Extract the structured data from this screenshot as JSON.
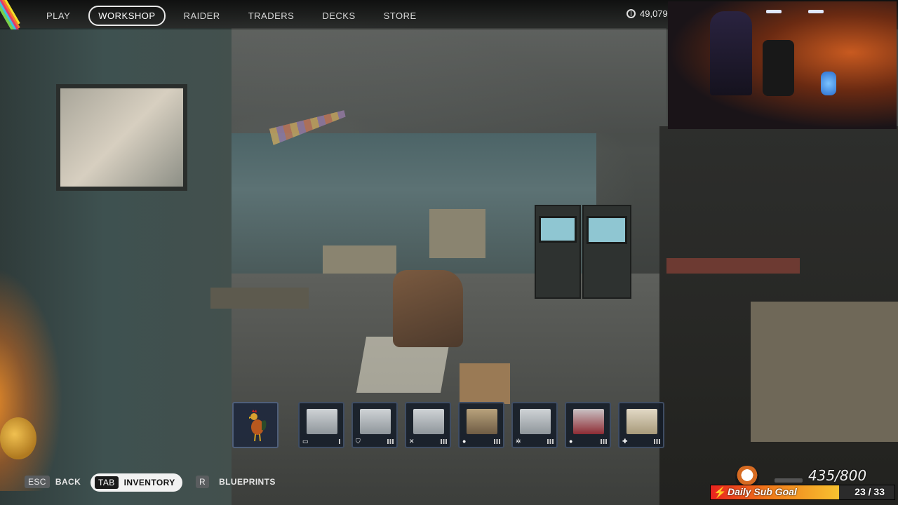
{
  "nav": {
    "items": [
      {
        "label": "PLAY"
      },
      {
        "label": "WORKSHOP",
        "active": true
      },
      {
        "label": "RAIDER"
      },
      {
        "label": "TRADERS"
      },
      {
        "label": "DECKS"
      },
      {
        "label": "STORE"
      }
    ],
    "currency": {
      "value": "49,079",
      "icon": "coin-icon"
    }
  },
  "inventory": {
    "featured": {
      "icon": "rooster-icon"
    },
    "slots": [
      {
        "name": "workstation-1",
        "badge_icon": "bench-icon",
        "level_bars": 1
      },
      {
        "name": "workstation-2",
        "badge_icon": "shield-icon",
        "level_bars": 3
      },
      {
        "name": "workstation-3",
        "badge_icon": "crossed-tools-icon",
        "level_bars": 3
      },
      {
        "name": "workstation-4",
        "badge_icon": "grenade-icon",
        "level_bars": 3
      },
      {
        "name": "workstation-5",
        "badge_icon": "gear-icon",
        "level_bars": 3
      },
      {
        "name": "workstation-6",
        "badge_icon": "flask-icon",
        "level_bars": 3
      },
      {
        "name": "workstation-7",
        "badge_icon": "medical-cross-icon",
        "level_bars": 3
      }
    ]
  },
  "hints": {
    "back": {
      "key": "ESC",
      "label": "BACK"
    },
    "inventory": {
      "key": "TAB",
      "label": "INVENTORY"
    },
    "blueprints": {
      "key": "R",
      "label": "BLUEPRINTS"
    }
  },
  "sub_goal": {
    "overall": "435/800",
    "label": "Daily Sub Goal",
    "count": "23 / 33",
    "progress": 0.697,
    "colors": {
      "start": "#e8231f",
      "mid": "#f07a1a",
      "end": "#f7c230"
    }
  }
}
